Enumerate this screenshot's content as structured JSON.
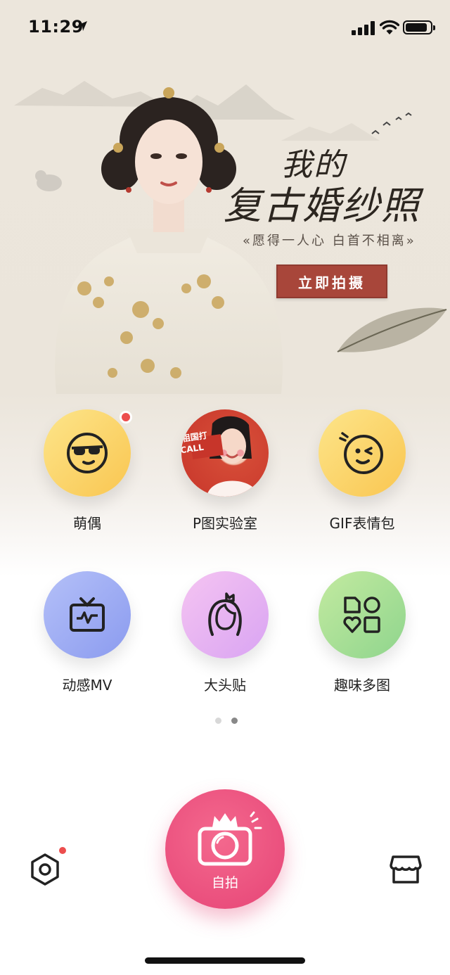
{
  "status_bar": {
    "time": "11:29",
    "icons": [
      "location-arrow-icon",
      "cellular-signal-icon",
      "wifi-icon",
      "battery-icon"
    ]
  },
  "banner": {
    "title_line1": "我的",
    "title_line2": "复古婚纱照",
    "subtitle": "«愿得一人心 白首不相离»",
    "cta_label": "立即拍摄",
    "cta_color": "#a8463a"
  },
  "features": [
    {
      "label": "萌偶",
      "icon": "cool-face-icon",
      "has_badge": true
    },
    {
      "label": "P图实验室",
      "icon": "portrait-photo",
      "photo_text": "为祖国打CALL"
    },
    {
      "label": "GIF表情包",
      "icon": "wink-face-icon"
    },
    {
      "label": "动感MV",
      "icon": "tv-icon"
    },
    {
      "label": "大头贴",
      "icon": "princess-face-icon"
    },
    {
      "label": "趣味多图",
      "icon": "shapes-grid-icon"
    }
  ],
  "pager": {
    "pages": 2,
    "current": 2
  },
  "bottom_bar": {
    "settings_icon": "settings-hexagon-icon",
    "settings_badge": true,
    "selfie_label": "自拍",
    "selfie_icon": "camera-crown-icon",
    "shop_icon": "store-icon",
    "accent_color": "#e64476"
  }
}
